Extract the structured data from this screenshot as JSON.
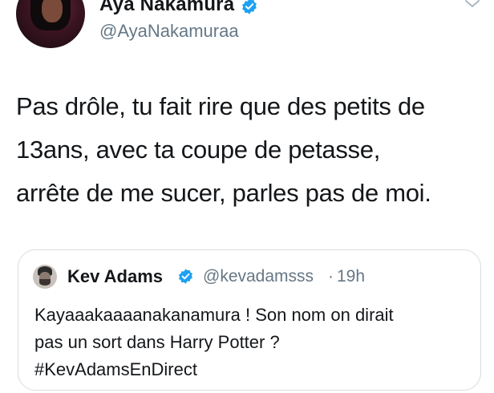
{
  "tweet": {
    "author_name": "Aya Nakamura",
    "author_handle": "@AyaNakamuraa",
    "text": "Pas drôle, tu fait rire que des petits de\n13ans, avec ta coupe de petasse,\narrête de me sucer, parles pas de moi.",
    "icons": {
      "avatar": "user-avatar",
      "verified": "verified-badge-icon",
      "menu": "chevron-down-icon"
    }
  },
  "quoted_tweet": {
    "author_name": "Kev Adams",
    "author_handle": "@kevadamsss",
    "separator": "·",
    "time": "19h",
    "text": "Kayaaakaaaanakanamura ! Son nom on dirait\npas un sort dans Harry Potter ?\n#KevAdamsEnDirect",
    "icons": {
      "avatar": "user-avatar",
      "verified": "verified-badge-icon"
    }
  },
  "colors": {
    "text_primary": "#14171a",
    "text_secondary": "#657786",
    "verified_blue": "#1da1f2",
    "card_border": "#d6dde2",
    "background": "#ffffff"
  }
}
